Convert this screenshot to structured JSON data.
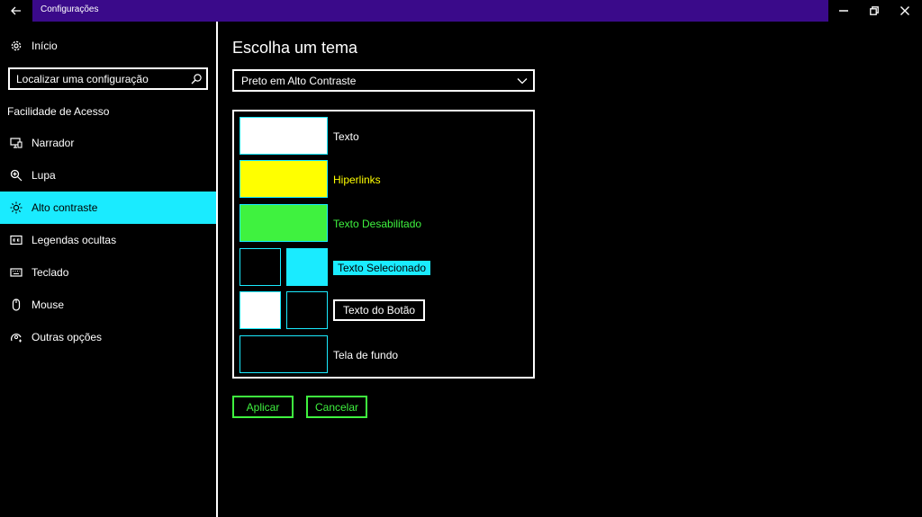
{
  "window": {
    "title": "Configurações"
  },
  "sidebar": {
    "home_label": "Início",
    "search_placeholder": "Localizar uma configuração",
    "section_label": "Facilidade de Acesso",
    "items": [
      {
        "label": "Narrador",
        "icon": "monitor-speaker-icon",
        "active": false
      },
      {
        "label": "Lupa",
        "icon": "magnifier-icon",
        "active": false
      },
      {
        "label": "Alto contraste",
        "icon": "brightness-icon",
        "active": true
      },
      {
        "label": "Legendas ocultas",
        "icon": "closed-captions-icon",
        "active": false
      },
      {
        "label": "Teclado",
        "icon": "keyboard-icon",
        "active": false
      },
      {
        "label": "Mouse",
        "icon": "mouse-icon",
        "active": false
      },
      {
        "label": "Outras opções",
        "icon": "other-options-icon",
        "active": false
      }
    ]
  },
  "main": {
    "heading": "Escolha um tema",
    "theme_selected": "Preto em Alto Contraste",
    "rows": [
      {
        "label": "Texto",
        "color": "#ffffff"
      },
      {
        "label": "Hiperlinks",
        "color": "#ffff00"
      },
      {
        "label": "Texto Desabilitado",
        "color": "#3ff23f"
      },
      {
        "label": "Texto Selecionado",
        "fg": "#000000",
        "bg": "#1aebff"
      },
      {
        "label": "Texto do Botão",
        "fg": "#ffffff",
        "bg": "#000000"
      },
      {
        "label": "Tela de fundo",
        "color": "#000000"
      }
    ],
    "apply_label": "Aplicar",
    "cancel_label": "Cancelar"
  },
  "colors": {
    "accent": "#1aebff",
    "titlebar": "#3a0a8a",
    "hyperlink": "#ffff00",
    "disabled": "#3ff23f"
  }
}
